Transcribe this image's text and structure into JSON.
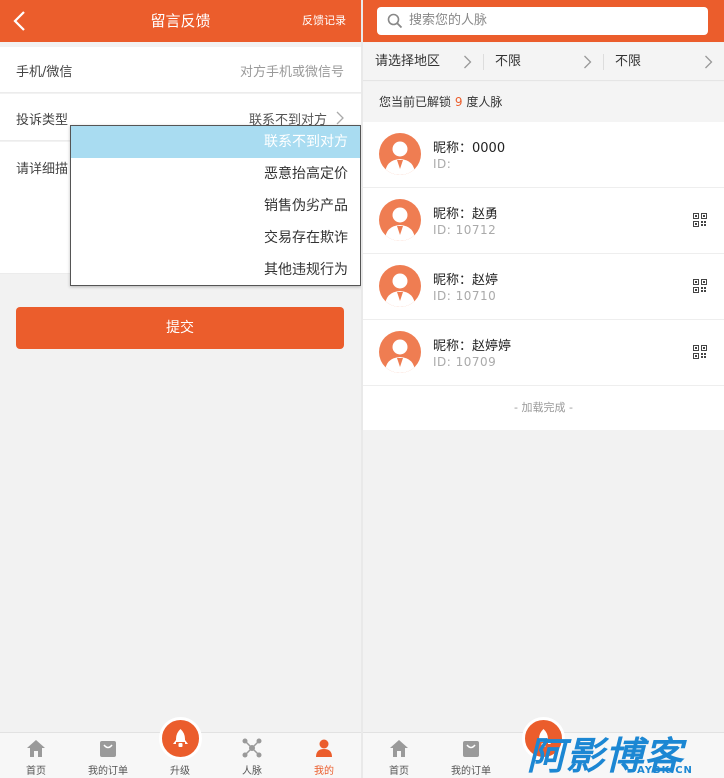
{
  "left": {
    "header": {
      "title": "留言反馈",
      "link": "反馈记录"
    },
    "rows": {
      "contact_label": "手机/微信",
      "contact_placeholder": "对方手机或微信号",
      "type_label": "投诉类型",
      "type_value": "联系不到对方",
      "detail_label": "请详细描"
    },
    "dropdown": {
      "options": [
        "联系不到对方",
        "恶意抬高定价",
        "销售伪劣产品",
        "交易存在欺诈",
        "其他违规行为"
      ],
      "selected": "联系不到对方"
    },
    "submit_label": "提交",
    "tabs": [
      "首页",
      "我的订单",
      "升级",
      "人脉",
      "我的"
    ],
    "active_tab": "我的"
  },
  "right": {
    "search_placeholder": "搜索您的人脉",
    "filters": [
      "请选择地区",
      "不限",
      "不限"
    ],
    "unlock": {
      "prefix": "您当前已解锁",
      "count": "9",
      "suffix": "度人脉"
    },
    "people": [
      {
        "name": "昵称：0000",
        "id": "ID:",
        "has_qr": false
      },
      {
        "name": "昵称：赵勇",
        "id": "ID: 10712",
        "has_qr": true
      },
      {
        "name": "昵称：赵婷",
        "id": "ID: 10710",
        "has_qr": true
      },
      {
        "name": "昵称：赵婷婷",
        "id": "ID: 10709",
        "has_qr": true
      }
    ],
    "load_done": "- 加载完成 -",
    "tabs_visible": [
      "首页",
      "我的订单"
    ]
  },
  "watermark": {
    "text": "阿影博客",
    "sub": "AYBK.CN"
  },
  "colors": {
    "accent": "#eb5d2c",
    "selected_option": "#a9dcf1",
    "watermark": "#1c87d3"
  }
}
